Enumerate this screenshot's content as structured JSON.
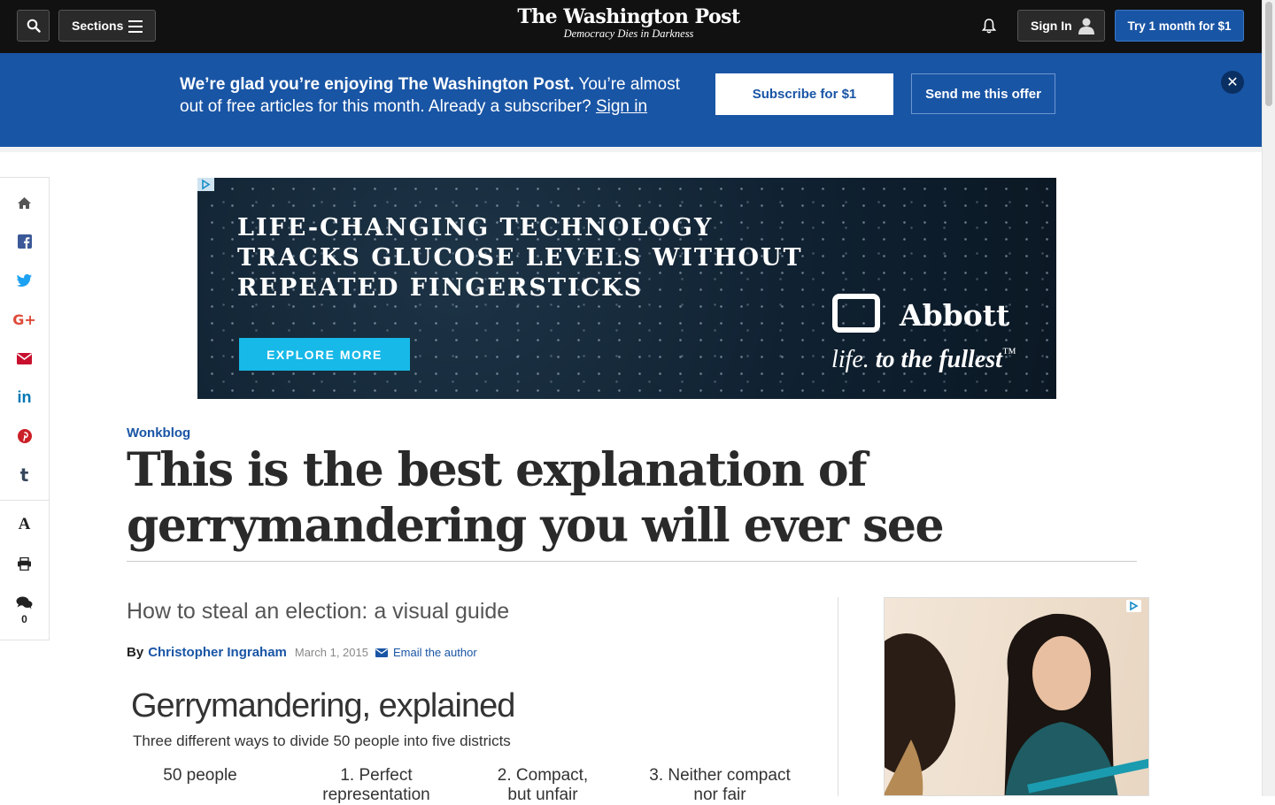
{
  "topbar": {
    "sections_label": "Sections",
    "logo_name": "The Washington Post",
    "logo_tagline": "Democracy Dies in Darkness",
    "signin_label": "Sign In",
    "try_label": "Try 1 month for $1"
  },
  "banner": {
    "bold_text": "We’re glad you’re enjoying The Washington Post.",
    "text": " You’re almost out of free articles for this month. Already a subscriber? ",
    "signin_link": "Sign in",
    "subscribe_label": "Subscribe for $1",
    "send_label": "Send me this offer",
    "close_label": "✕"
  },
  "share_rail": {
    "comment_count": "0"
  },
  "ad": {
    "headline_lines": [
      "LIFE-CHANGING TECHNOLOGY",
      "TRACKS GLUCOSE LEVELS WITHOUT",
      "REPEATED FINGERSTICKS"
    ],
    "cta": "EXPLORE MORE",
    "brand": "Abbott",
    "slogan_a": "life.",
    "slogan_b": " to the fullest",
    "slogan_tm": "™"
  },
  "article": {
    "kicker": "Wonkblog",
    "headline": "This is the best explanation of gerrymandering you will ever see",
    "subhead": "How to steal an election: a visual guide",
    "by": "By",
    "author": "Christopher Ingraham",
    "date": "March 1, 2015",
    "email_label": "Email the author"
  },
  "graphic": {
    "title": "Gerrymandering, explained",
    "subtitle": "Three different ways to divide 50 people into five districts",
    "columns": [
      "50 people",
      "1. Perfect representation",
      "2. Compact, but unfair",
      "3. Neither compact nor fair"
    ]
  },
  "colors": {
    "brand_blue": "#1955a5",
    "topbar": "#111111",
    "ad_cta": "#17b9e8"
  }
}
